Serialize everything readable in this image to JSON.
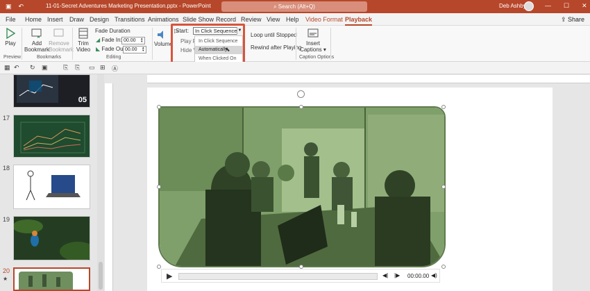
{
  "titlebar": {
    "save_icon": "save-icon",
    "undo_icon": "undo-icon",
    "doc_title": "11-01-Secret Adventures Marketing Presentation.pptx  -  PowerPoint",
    "search_placeholder": "Search (Alt+Q)",
    "user_name": "Deb Ashby",
    "minimize": "—",
    "maximize": "☐",
    "close": "✕"
  },
  "tabs": [
    "File",
    "Home",
    "Insert",
    "Draw",
    "Design",
    "Transitions",
    "Animations",
    "Slide Show",
    "Record",
    "Review",
    "View",
    "Help",
    "Video Format",
    "Playback"
  ],
  "active_tab": "Playback",
  "share_label": "Share",
  "ribbon": {
    "preview": {
      "play_label": "Play",
      "group_label": "Preview"
    },
    "bookmarks": {
      "add_label": "Add Bookmark",
      "remove_label": "Remove Bookmark",
      "group_label": "Bookmarks"
    },
    "editing": {
      "trim_label": "Trim Video",
      "fade_duration_label": "Fade Duration",
      "fade_in_label": "Fade In:",
      "fade_in_value": "00.00",
      "fade_out_label": "Fade Out:",
      "fade_out_value": "00.00",
      "group_label": "Editing"
    },
    "video_options": {
      "volume_label": "Volume",
      "start_label": "Start:",
      "start_value": "In Click Sequence",
      "play_full_label": "Play Fu",
      "hide_label": "Hide V",
      "loop_label": "Loop until Stopped",
      "rewind_label": "Rewind after Playing"
    },
    "start_options": [
      "In Click Sequence",
      "Automatically",
      "When Clicked On"
    ],
    "hovered_option": "Automatically",
    "captions": {
      "insert_label": "Insert Captions",
      "group_label": "Caption Options"
    }
  },
  "slides": [
    {
      "number": "",
      "label": "05"
    },
    {
      "number": "17",
      "label": ""
    },
    {
      "number": "18",
      "label": ""
    },
    {
      "number": "19",
      "label": ""
    },
    {
      "number": "20",
      "label": ""
    }
  ],
  "player": {
    "time": "00:00.00"
  },
  "colors": {
    "accent": "#b7472a",
    "highlight": "#d9533c",
    "video_tint": "#7fa06a"
  }
}
